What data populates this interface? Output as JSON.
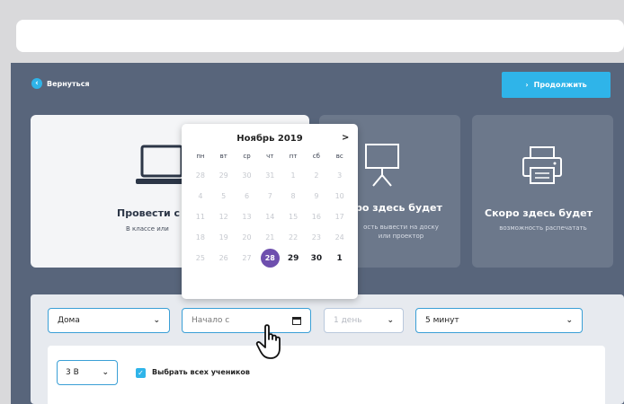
{
  "nav": {
    "back_label": "Вернуться",
    "continue_label": "Продолжить"
  },
  "cards": [
    {
      "title": "Провести с",
      "description": "В классе или"
    },
    {
      "title": "ро здесь будет",
      "description_line1": "ость вывести на доску",
      "description_line2": "или проектор"
    },
    {
      "title": "Скоро здесь будет",
      "description": "возможность распечатать"
    }
  ],
  "calendar": {
    "month": "Ноябрь 2019",
    "next": ">",
    "weekdays": [
      "пн",
      "вт",
      "ср",
      "чт",
      "пт",
      "сб",
      "вс"
    ],
    "weeks": [
      [
        "28",
        "29",
        "30",
        "31",
        "1",
        "2",
        "3"
      ],
      [
        "4",
        "5",
        "6",
        "7",
        "8",
        "9",
        "10"
      ],
      [
        "11",
        "12",
        "13",
        "14",
        "15",
        "16",
        "17"
      ],
      [
        "18",
        "19",
        "20",
        "21",
        "22",
        "23",
        "24"
      ],
      [
        "25",
        "26",
        "27",
        "28",
        "29",
        "30",
        "1"
      ]
    ],
    "selected_day": "28"
  },
  "form": {
    "place_value": "Дома",
    "start_placeholder": "Начало с",
    "days_value": "1 день",
    "duration_value": "5 минут",
    "class_value": "3 В",
    "select_all_label": "Выбрать всех учеников"
  },
  "colors": {
    "accent": "#2fb4e9",
    "background": "#58657b",
    "selected": "#6e4fae"
  }
}
